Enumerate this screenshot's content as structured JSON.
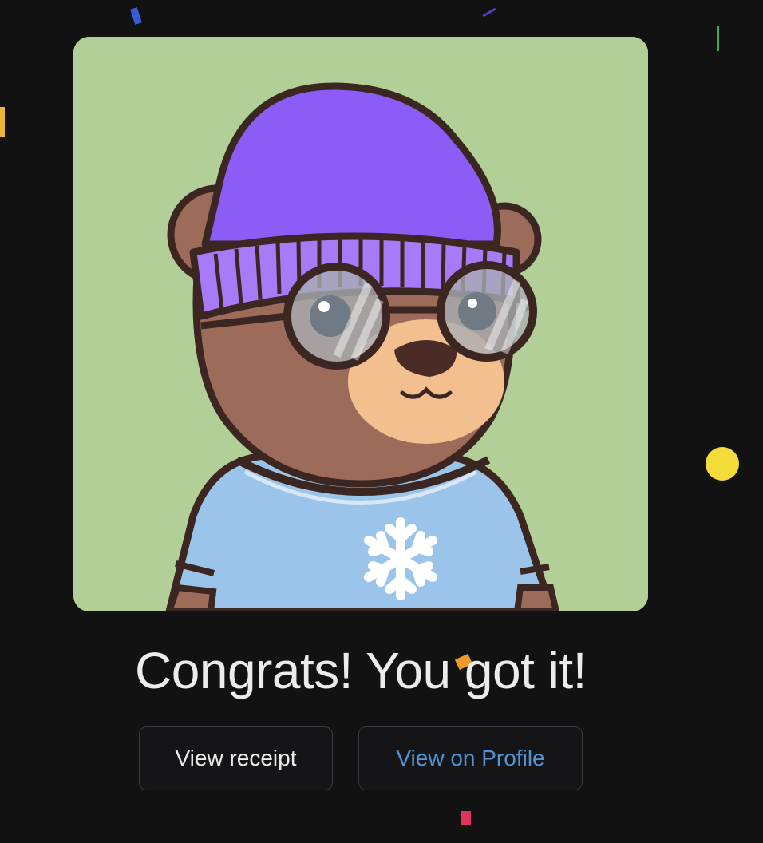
{
  "nft": {
    "image_icon": "bear-nft-icon",
    "background_color": "#b1cf97",
    "hat_color": "#8b5cf6",
    "shirt_color": "#9bc4ea",
    "fur_color": "#9d6b5a"
  },
  "message": {
    "title": "Congrats! You got it!"
  },
  "actions": {
    "receipt_label": "View receipt",
    "profile_label": "View on Profile",
    "profile_color": "#4f94d4"
  },
  "theme": {
    "background": "#121212",
    "button_border": "#3a3b3f"
  },
  "confetti": {
    "colors": [
      "#3a5bd9",
      "#5a3fb8",
      "#3fae49",
      "#f0b43a",
      "#f3dc3a",
      "#f6e24a",
      "#f09a2c",
      "#e0355a"
    ]
  }
}
